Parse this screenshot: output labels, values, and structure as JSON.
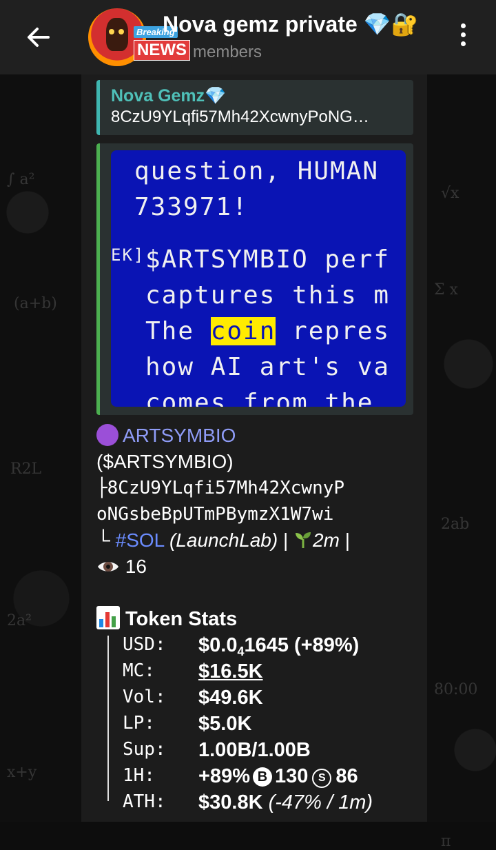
{
  "header": {
    "title": "Nova gemz private 💎🔐",
    "subtitle": "members",
    "avatar_tag_small": "Breaking",
    "avatar_tag_big": "NEWS"
  },
  "reply": {
    "name": "Nova Gemz💎",
    "text": "8CzU9YLqfi57Mh42XcwnyPoNG…"
  },
  "media": {
    "lines": [
      "question, HUMAN",
      "733971!",
      "$ARTSYMBIO perf",
      "captures this m",
      "The ",
      "coin",
      " repres",
      "how AI art's va",
      "comes from the"
    ],
    "prefix": "EK]"
  },
  "message": {
    "token_name": "ARTSYMBIO",
    "token_symbol": "($ARTSYMBIO)",
    "address_line1": "├8CzU9YLqfi57Mh42XcwnyP",
    "address_line2": "oNGsbeBpUTmPBymzX1W7wi",
    "chain_prefix": "└ ",
    "chain": "#SOL",
    "launch": "(LaunchLab)",
    "sep1": " | ",
    "age": "2m",
    "sep2": " |",
    "views": "16",
    "stats_title": "Token Stats"
  },
  "stats": [
    {
      "label": "USD:",
      "value_a": "$0.0",
      "value_sub": "4",
      "value_b": "1645 (+89%)"
    },
    {
      "label": "MC:",
      "value": "$16.5K"
    },
    {
      "label": "Vol:",
      "value": "$49.6K"
    },
    {
      "label": "LP:",
      "value": "$5.0K"
    },
    {
      "label": "Sup:",
      "value": "1.00B/1.00B"
    },
    {
      "label": "1H:",
      "value_a": "+89%",
      "badge_b": "B",
      "value_b": "130",
      "badge_s": "S",
      "value_c": "86"
    },
    {
      "label": "ATH:",
      "value_a": "$30.8K ",
      "value_b": "(-47% / 1m)"
    }
  ]
}
